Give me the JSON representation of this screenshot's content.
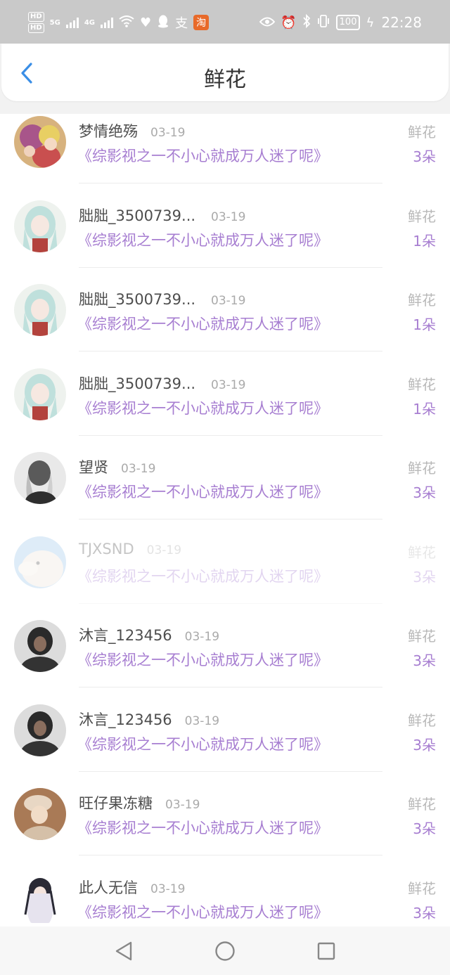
{
  "status_bar": {
    "hd1": "HD",
    "hd2": "HD",
    "net1": "5G",
    "net2": "4G",
    "alipay": "支",
    "taobao": "淘",
    "battery": "100",
    "time": "22:28"
  },
  "header": {
    "title": "鲜花"
  },
  "items": [
    {
      "username": "梦情绝殇",
      "date": "03-19",
      "book": "《综影视之一不小心就成万人迷了呢》",
      "gift_label": "鲜花",
      "gift_count": "3朵"
    },
    {
      "username": "胐胐_3500739...",
      "date": "03-19",
      "book": "《综影视之一不小心就成万人迷了呢》",
      "gift_label": "鲜花",
      "gift_count": "1朵"
    },
    {
      "username": "胐胐_3500739...",
      "date": "03-19",
      "book": "《综影视之一不小心就成万人迷了呢》",
      "gift_label": "鲜花",
      "gift_count": "1朵"
    },
    {
      "username": "胐胐_3500739...",
      "date": "03-19",
      "book": "《综影视之一不小心就成万人迷了呢》",
      "gift_label": "鲜花",
      "gift_count": "1朵"
    },
    {
      "username": "望贤",
      "date": "03-19",
      "book": "《综影视之一不小心就成万人迷了呢》",
      "gift_label": "鲜花",
      "gift_count": "3朵"
    },
    {
      "username": "TJXSND",
      "date": "03-19",
      "book": "《综影视之一不小心就成万人迷了呢》",
      "gift_label": "鲜花",
      "gift_count": "3朵"
    },
    {
      "username": "沐言_123456",
      "date": "03-19",
      "book": "《综影视之一不小心就成万人迷了呢》",
      "gift_label": "鲜花",
      "gift_count": "3朵"
    },
    {
      "username": "沐言_123456",
      "date": "03-19",
      "book": "《综影视之一不小心就成万人迷了呢》",
      "gift_label": "鲜花",
      "gift_count": "3朵"
    },
    {
      "username": "旺仔果冻糖",
      "date": "03-19",
      "book": "《综影视之一不小心就成万人迷了呢》",
      "gift_label": "鲜花",
      "gift_count": "3朵"
    },
    {
      "username": "此人无信",
      "date": "03-19",
      "book": "《综影视之一不小心就成万人迷了呢》",
      "gift_label": "鲜花",
      "gift_count": "3朵"
    }
  ],
  "colors": {
    "accent_blue": "#3a8ee6",
    "purple_text": "#a77ed1",
    "status_bar_bg": "#c9c9c9"
  }
}
